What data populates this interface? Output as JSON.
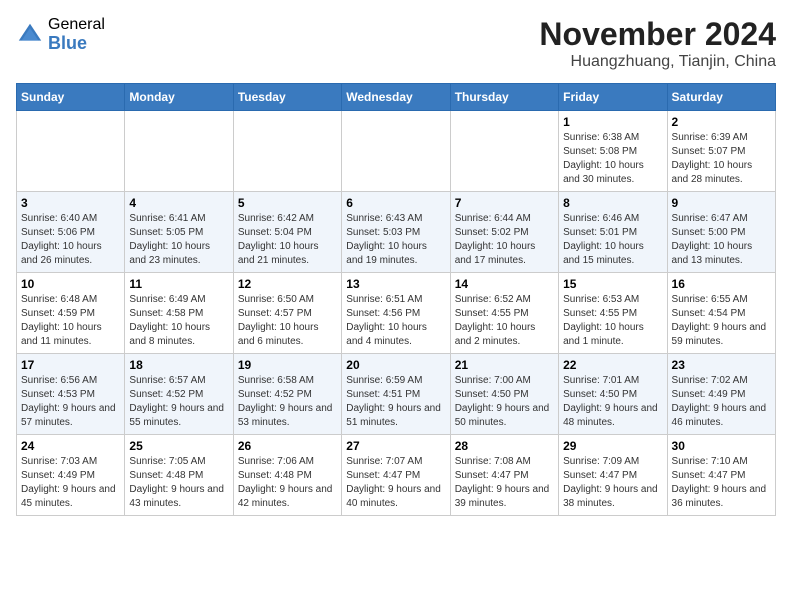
{
  "header": {
    "logo_general": "General",
    "logo_blue": "Blue",
    "month_title": "November 2024",
    "location": "Huangzhuang, Tianjin, China"
  },
  "weekdays": [
    "Sunday",
    "Monday",
    "Tuesday",
    "Wednesday",
    "Thursday",
    "Friday",
    "Saturday"
  ],
  "weeks": [
    [
      {
        "day": "",
        "info": ""
      },
      {
        "day": "",
        "info": ""
      },
      {
        "day": "",
        "info": ""
      },
      {
        "day": "",
        "info": ""
      },
      {
        "day": "",
        "info": ""
      },
      {
        "day": "1",
        "info": "Sunrise: 6:38 AM\nSunset: 5:08 PM\nDaylight: 10 hours and 30 minutes."
      },
      {
        "day": "2",
        "info": "Sunrise: 6:39 AM\nSunset: 5:07 PM\nDaylight: 10 hours and 28 minutes."
      }
    ],
    [
      {
        "day": "3",
        "info": "Sunrise: 6:40 AM\nSunset: 5:06 PM\nDaylight: 10 hours and 26 minutes."
      },
      {
        "day": "4",
        "info": "Sunrise: 6:41 AM\nSunset: 5:05 PM\nDaylight: 10 hours and 23 minutes."
      },
      {
        "day": "5",
        "info": "Sunrise: 6:42 AM\nSunset: 5:04 PM\nDaylight: 10 hours and 21 minutes."
      },
      {
        "day": "6",
        "info": "Sunrise: 6:43 AM\nSunset: 5:03 PM\nDaylight: 10 hours and 19 minutes."
      },
      {
        "day": "7",
        "info": "Sunrise: 6:44 AM\nSunset: 5:02 PM\nDaylight: 10 hours and 17 minutes."
      },
      {
        "day": "8",
        "info": "Sunrise: 6:46 AM\nSunset: 5:01 PM\nDaylight: 10 hours and 15 minutes."
      },
      {
        "day": "9",
        "info": "Sunrise: 6:47 AM\nSunset: 5:00 PM\nDaylight: 10 hours and 13 minutes."
      }
    ],
    [
      {
        "day": "10",
        "info": "Sunrise: 6:48 AM\nSunset: 4:59 PM\nDaylight: 10 hours and 11 minutes."
      },
      {
        "day": "11",
        "info": "Sunrise: 6:49 AM\nSunset: 4:58 PM\nDaylight: 10 hours and 8 minutes."
      },
      {
        "day": "12",
        "info": "Sunrise: 6:50 AM\nSunset: 4:57 PM\nDaylight: 10 hours and 6 minutes."
      },
      {
        "day": "13",
        "info": "Sunrise: 6:51 AM\nSunset: 4:56 PM\nDaylight: 10 hours and 4 minutes."
      },
      {
        "day": "14",
        "info": "Sunrise: 6:52 AM\nSunset: 4:55 PM\nDaylight: 10 hours and 2 minutes."
      },
      {
        "day": "15",
        "info": "Sunrise: 6:53 AM\nSunset: 4:55 PM\nDaylight: 10 hours and 1 minute."
      },
      {
        "day": "16",
        "info": "Sunrise: 6:55 AM\nSunset: 4:54 PM\nDaylight: 9 hours and 59 minutes."
      }
    ],
    [
      {
        "day": "17",
        "info": "Sunrise: 6:56 AM\nSunset: 4:53 PM\nDaylight: 9 hours and 57 minutes."
      },
      {
        "day": "18",
        "info": "Sunrise: 6:57 AM\nSunset: 4:52 PM\nDaylight: 9 hours and 55 minutes."
      },
      {
        "day": "19",
        "info": "Sunrise: 6:58 AM\nSunset: 4:52 PM\nDaylight: 9 hours and 53 minutes."
      },
      {
        "day": "20",
        "info": "Sunrise: 6:59 AM\nSunset: 4:51 PM\nDaylight: 9 hours and 51 minutes."
      },
      {
        "day": "21",
        "info": "Sunrise: 7:00 AM\nSunset: 4:50 PM\nDaylight: 9 hours and 50 minutes."
      },
      {
        "day": "22",
        "info": "Sunrise: 7:01 AM\nSunset: 4:50 PM\nDaylight: 9 hours and 48 minutes."
      },
      {
        "day": "23",
        "info": "Sunrise: 7:02 AM\nSunset: 4:49 PM\nDaylight: 9 hours and 46 minutes."
      }
    ],
    [
      {
        "day": "24",
        "info": "Sunrise: 7:03 AM\nSunset: 4:49 PM\nDaylight: 9 hours and 45 minutes."
      },
      {
        "day": "25",
        "info": "Sunrise: 7:05 AM\nSunset: 4:48 PM\nDaylight: 9 hours and 43 minutes."
      },
      {
        "day": "26",
        "info": "Sunrise: 7:06 AM\nSunset: 4:48 PM\nDaylight: 9 hours and 42 minutes."
      },
      {
        "day": "27",
        "info": "Sunrise: 7:07 AM\nSunset: 4:47 PM\nDaylight: 9 hours and 40 minutes."
      },
      {
        "day": "28",
        "info": "Sunrise: 7:08 AM\nSunset: 4:47 PM\nDaylight: 9 hours and 39 minutes."
      },
      {
        "day": "29",
        "info": "Sunrise: 7:09 AM\nSunset: 4:47 PM\nDaylight: 9 hours and 38 minutes."
      },
      {
        "day": "30",
        "info": "Sunrise: 7:10 AM\nSunset: 4:47 PM\nDaylight: 9 hours and 36 minutes."
      }
    ]
  ]
}
